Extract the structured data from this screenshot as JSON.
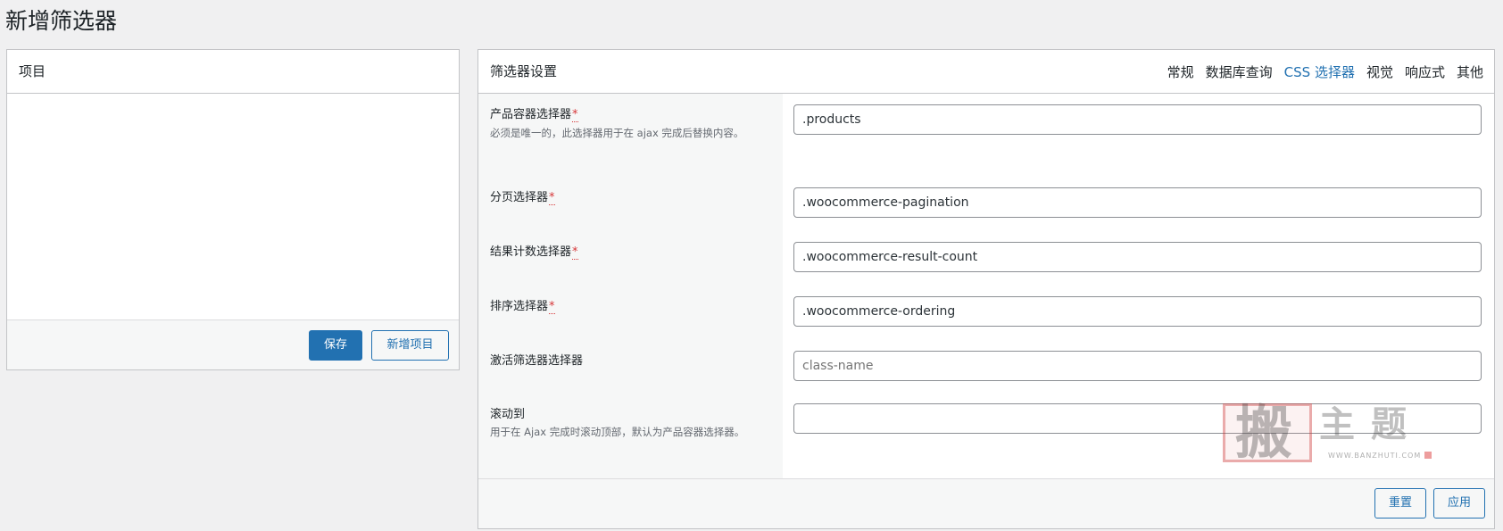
{
  "page": {
    "title": "新增筛选器"
  },
  "items_panel": {
    "title": "项目",
    "save_button": "保存",
    "add_item_button": "新增项目"
  },
  "settings_panel": {
    "title": "筛选器设置",
    "tabs": [
      {
        "label": "常规",
        "active": false
      },
      {
        "label": "数据库查询",
        "active": false
      },
      {
        "label": "CSS 选择器",
        "active": true
      },
      {
        "label": "视觉",
        "active": false
      },
      {
        "label": "响应式",
        "active": false
      },
      {
        "label": "其他",
        "active": false
      }
    ],
    "fields": [
      {
        "label": "产品容器选择器",
        "required_mark": "*",
        "description": "必须是唯一的，此选择器用于在 ajax 完成后替换内容。",
        "value": ".products",
        "placeholder": ""
      },
      {
        "label": "分页选择器",
        "required_mark": "*",
        "description": "",
        "value": ".woocommerce-pagination",
        "placeholder": ""
      },
      {
        "label": "结果计数选择器",
        "required_mark": "*",
        "description": "",
        "value": ".woocommerce-result-count",
        "placeholder": ""
      },
      {
        "label": "排序选择器",
        "required_mark": "*",
        "description": "",
        "value": ".woocommerce-ordering",
        "placeholder": ""
      },
      {
        "label": "激活筛选器选择器",
        "required_mark": "",
        "description": "",
        "value": "",
        "placeholder": "class-name"
      },
      {
        "label": "滚动到",
        "required_mark": "",
        "description": "用于在 Ajax 完成时滚动顶部，默认为产品容器选择器。",
        "value": "",
        "placeholder": ""
      }
    ],
    "reset_button": "重置",
    "apply_button": "应用"
  },
  "watermark": {
    "big_char": "搬",
    "chars": "主题",
    "url": "WWW.BANZHUTI.COM"
  },
  "colors": {
    "background": "#f0f0f1",
    "accent": "#2271b1",
    "required": "#d63638",
    "border": "#c3c4c7"
  }
}
